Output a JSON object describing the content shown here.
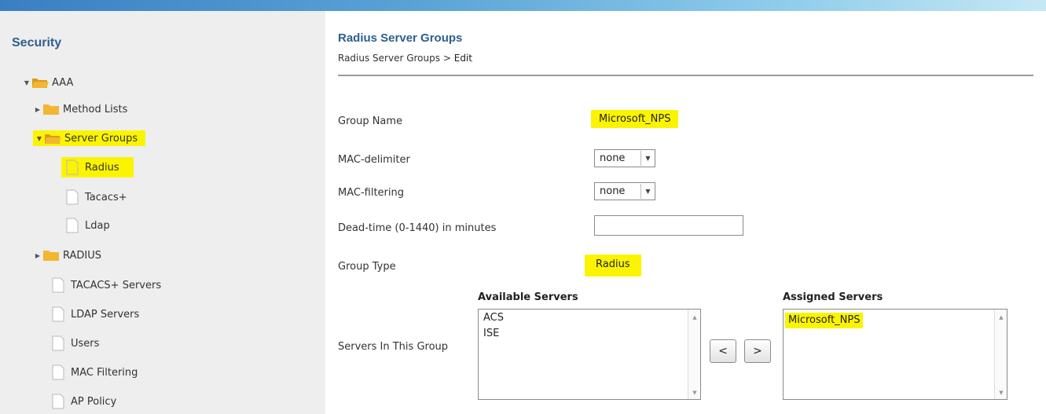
{
  "sidebar": {
    "title": "Security",
    "items": [
      {
        "label": "AAA"
      },
      {
        "label": "Method Lists"
      },
      {
        "label": "Server Groups"
      },
      {
        "label": "Radius"
      },
      {
        "label": "Tacacs+"
      },
      {
        "label": "Ldap"
      },
      {
        "label": "RADIUS"
      },
      {
        "label": "TACACS+ Servers"
      },
      {
        "label": "LDAP Servers"
      },
      {
        "label": "Users"
      },
      {
        "label": "MAC Filtering"
      },
      {
        "label": "AP Policy"
      }
    ]
  },
  "header": {
    "title": "Radius Server Groups",
    "breadcrumb_parent": "Radius Server Groups",
    "breadcrumb_sep": ">",
    "breadcrumb_current": "Edit"
  },
  "form": {
    "group_name_label": "Group Name",
    "group_name_value": "Microsoft_NPS",
    "mac_delimiter_label": "MAC-delimiter",
    "mac_delimiter_value": "none",
    "mac_filtering_label": "MAC-filtering",
    "mac_filtering_value": "none",
    "dead_time_label": "Dead-time (0-1440) in minutes",
    "dead_time_value": "",
    "group_type_label": "Group Type",
    "group_type_value": "Radius",
    "servers_label": "Servers In This Group"
  },
  "servers": {
    "available_header": "Available Servers",
    "available": [
      "ACS",
      "ISE"
    ],
    "assigned_header": "Assigned Servers",
    "assigned": [
      "Microsoft_NPS"
    ],
    "move_left_label": "<",
    "move_right_label": ">"
  },
  "colors": {
    "highlight": "#fbf400",
    "title_blue": "#2d5f8f",
    "folder": "#f2b632"
  }
}
